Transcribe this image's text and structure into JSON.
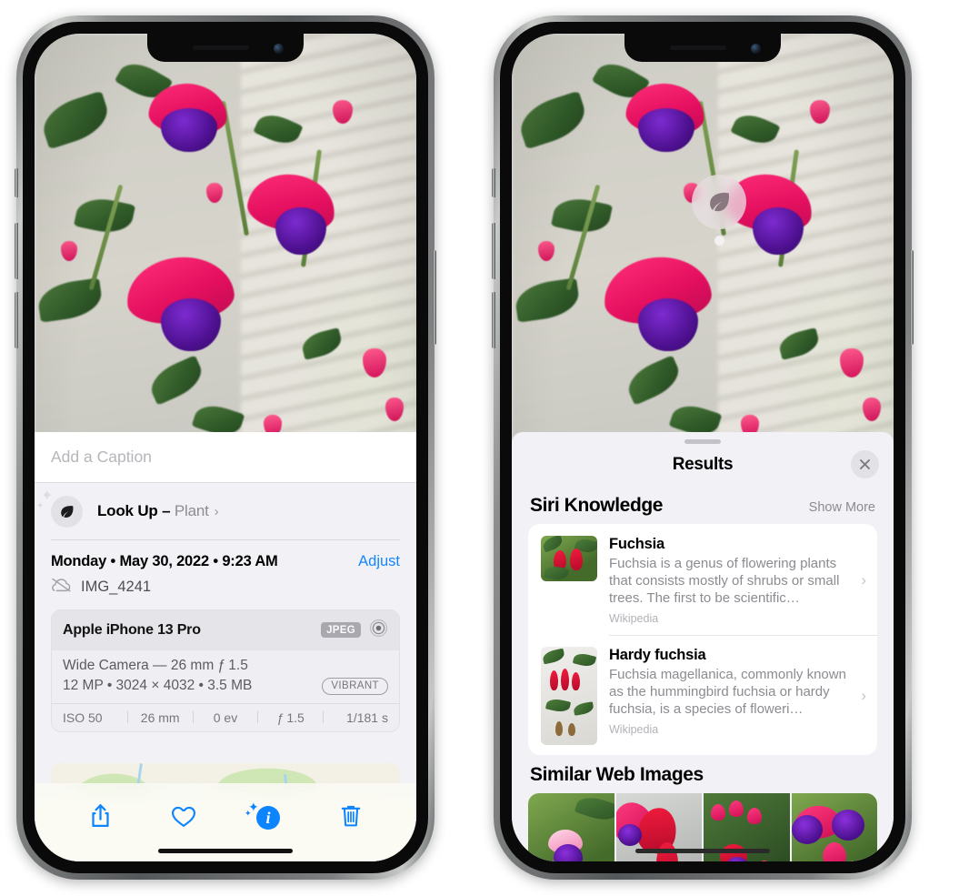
{
  "left_phone": {
    "caption_placeholder": "Add a Caption",
    "lookup": {
      "label": "Look Up – ",
      "subject": "Plant",
      "chevron": "›",
      "icon": "leaf-icon"
    },
    "metadata": {
      "date_line": "Monday • May 30, 2022 • 9:23 AM",
      "adjust_label": "Adjust",
      "filename": "IMG_4241",
      "cloud_icon": "icloud-slash-icon"
    },
    "camera_card": {
      "model": "Apple iPhone 13 Pro",
      "format_badge": "JPEG",
      "lens_icon": "aperture-icon",
      "lens_line": "Wide Camera — 26 mm ƒ 1.5",
      "specs_line": "12 MP • 3024 × 4032 • 3.5 MB",
      "style_badge": "VIBRANT",
      "exif": [
        "ISO 50",
        "26 mm",
        "0 ev",
        "ƒ 1.5",
        "1/181 s"
      ]
    },
    "toolbar": [
      {
        "name": "share-button",
        "icon": "share-icon"
      },
      {
        "name": "favorite-button",
        "icon": "heart-icon"
      },
      {
        "name": "info-button",
        "icon": "info-sparkle-icon"
      },
      {
        "name": "delete-button",
        "icon": "trash-icon"
      }
    ]
  },
  "right_phone": {
    "visual_lookup_badge": "leaf-icon",
    "panel": {
      "title": "Results",
      "close_label": "×"
    },
    "siri_knowledge": {
      "heading": "Siri Knowledge",
      "action": "Show More",
      "cards": [
        {
          "title": "Fuchsia",
          "description": "Fuchsia is a genus of flowering plants that consists mostly of shrubs or small trees. The first to be scientific…",
          "source": "Wikipedia",
          "chevron": "›"
        },
        {
          "title": "Hardy fuchsia",
          "description": "Fuchsia magellanica, commonly known as the hummingbird fuchsia or hardy fuchsia, is a species of floweri…",
          "source": "Wikipedia",
          "chevron": "›"
        }
      ]
    },
    "similar_web_images": {
      "heading": "Similar Web Images",
      "count": 4
    }
  },
  "colors": {
    "accent_blue": "#0b84fe",
    "panel_bg": "#f2f1f6",
    "card_bg": "#ffffff",
    "secondary_text": "#8b8b91"
  }
}
